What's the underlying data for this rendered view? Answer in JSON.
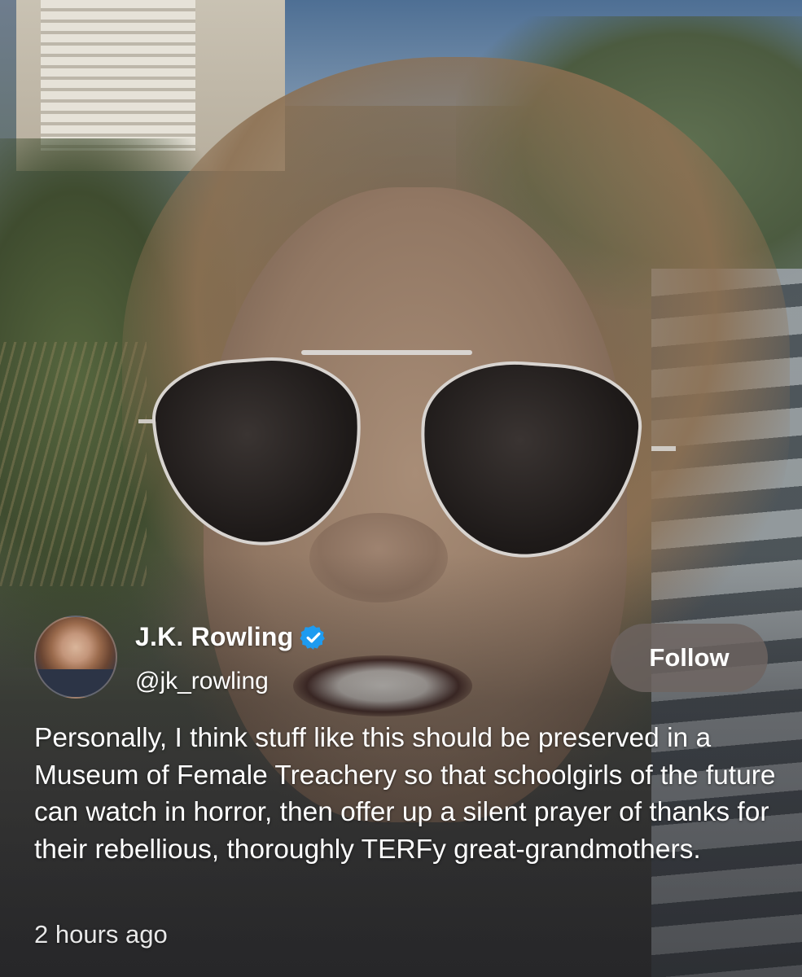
{
  "media": {
    "type": "video-still"
  },
  "tweet": {
    "author": {
      "display_name": "J.K. Rowling",
      "handle": "@jk_rowling",
      "verified": true,
      "verified_color": "#1d9bf0"
    },
    "follow_button": {
      "label": "Follow"
    },
    "text": "Personally, I think stuff like this should be preserved in a Museum of Female Treachery so that schoolgirls of the future can watch in horror, then offer up a silent prayer of thanks for their rebellious, thoroughly TERFy great-grandmothers.",
    "timestamp": "2 hours ago"
  },
  "icons": {
    "verified": "verified-badge-icon",
    "avatar": "profile-avatar"
  }
}
